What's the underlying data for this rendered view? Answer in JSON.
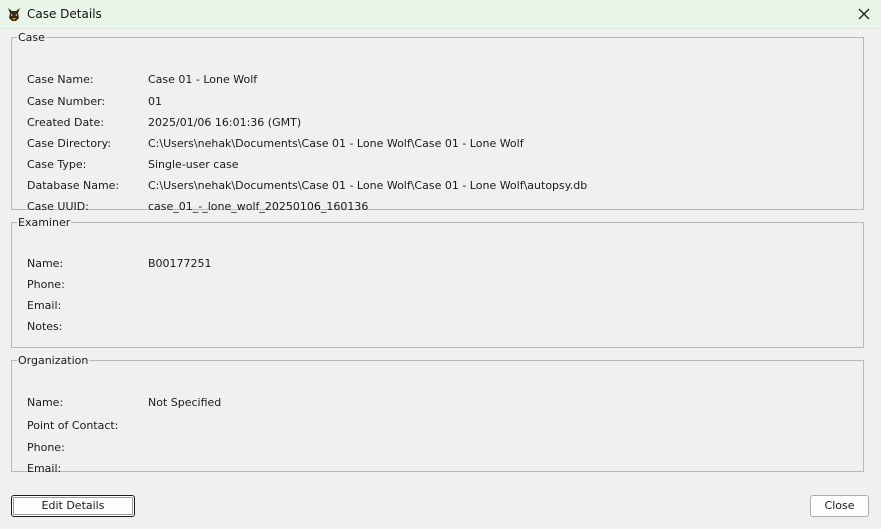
{
  "window": {
    "title": "Case Details",
    "icon": "autopsy-dog-icon"
  },
  "case": {
    "legend": "Case",
    "rows": [
      {
        "label": "Case Name:",
        "value": "Case 01 - Lone Wolf"
      },
      {
        "label": "Case Number:",
        "value": "01"
      },
      {
        "label": "Created Date:",
        "value": "2025/01/06 16:01:36 (GMT)"
      },
      {
        "label": "Case Directory:",
        "value": "C:\\Users\\nehak\\Documents\\Case 01 - Lone Wolf\\Case 01 - Lone Wolf"
      },
      {
        "label": "Case Type:",
        "value": "Single-user case"
      },
      {
        "label": "Database Name:",
        "value": "C:\\Users\\nehak\\Documents\\Case 01 - Lone Wolf\\Case 01 - Lone Wolf\\autopsy.db"
      },
      {
        "label": "Case UUID:",
        "value": "case_01_-_lone_wolf_20250106_160136"
      }
    ]
  },
  "examiner": {
    "legend": "Examiner",
    "rows": [
      {
        "label": "Name:",
        "value": "B00177251"
      },
      {
        "label": "Phone:",
        "value": ""
      },
      {
        "label": "Email:",
        "value": ""
      },
      {
        "label": "Notes:",
        "value": ""
      }
    ]
  },
  "organization": {
    "legend": "Organization",
    "rows": [
      {
        "label": "Name:",
        "value": "Not Specified"
      },
      {
        "label": "Point of Contact:",
        "value": ""
      },
      {
        "label": "Phone:",
        "value": ""
      },
      {
        "label": "Email:",
        "value": ""
      }
    ]
  },
  "buttons": {
    "edit_details": "Edit Details",
    "close": "Close"
  }
}
